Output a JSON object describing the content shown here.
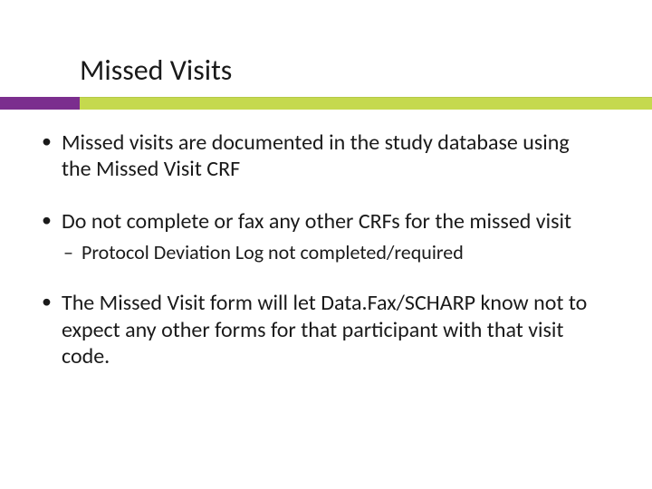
{
  "title": "Missed Visits",
  "bullets": [
    {
      "text": "Missed visits are documented in the study database using the Missed Visit CRF",
      "sub": []
    },
    {
      "text": "Do not complete or fax any other CRFs for the missed visit",
      "sub": [
        "Protocol Deviation Log not completed/required"
      ]
    },
    {
      "text": "The Missed Visit form will let Data.Fax/SCHARP know not to expect any other forms for that participant with that visit code.",
      "sub": []
    }
  ],
  "accent": {
    "purple": "#7b2e8e",
    "green": "#c5d94e"
  }
}
